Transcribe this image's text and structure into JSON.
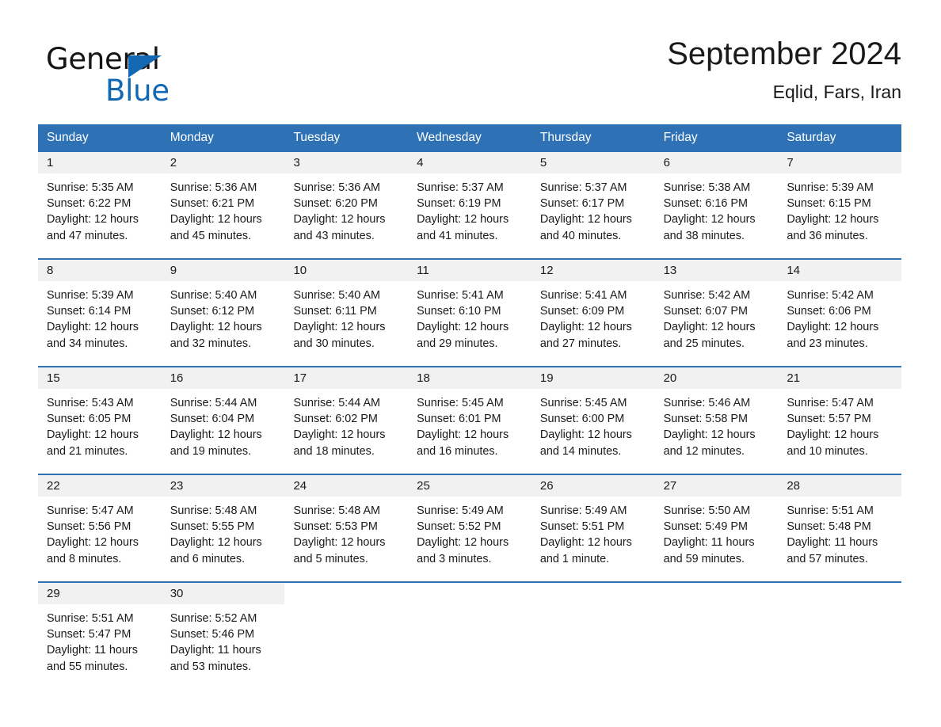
{
  "brand": {
    "name_dark": "General",
    "name_blue": "Blue",
    "accent_color": "#1268b3"
  },
  "header": {
    "month_title": "September 2024",
    "location": "Eqlid, Fars, Iran"
  },
  "theme": {
    "header_blue": "#2e72b5",
    "daynum_band": "#f1f1f1",
    "text": "#1a1a1a"
  },
  "weekdays": [
    "Sunday",
    "Monday",
    "Tuesday",
    "Wednesday",
    "Thursday",
    "Friday",
    "Saturday"
  ],
  "weeks": [
    {
      "days": [
        {
          "num": "1",
          "sunrise": "Sunrise: 5:35 AM",
          "sunset": "Sunset: 6:22 PM",
          "daylight1": "Daylight: 12 hours",
          "daylight2": "and 47 minutes."
        },
        {
          "num": "2",
          "sunrise": "Sunrise: 5:36 AM",
          "sunset": "Sunset: 6:21 PM",
          "daylight1": "Daylight: 12 hours",
          "daylight2": "and 45 minutes."
        },
        {
          "num": "3",
          "sunrise": "Sunrise: 5:36 AM",
          "sunset": "Sunset: 6:20 PM",
          "daylight1": "Daylight: 12 hours",
          "daylight2": "and 43 minutes."
        },
        {
          "num": "4",
          "sunrise": "Sunrise: 5:37 AM",
          "sunset": "Sunset: 6:19 PM",
          "daylight1": "Daylight: 12 hours",
          "daylight2": "and 41 minutes."
        },
        {
          "num": "5",
          "sunrise": "Sunrise: 5:37 AM",
          "sunset": "Sunset: 6:17 PM",
          "daylight1": "Daylight: 12 hours",
          "daylight2": "and 40 minutes."
        },
        {
          "num": "6",
          "sunrise": "Sunrise: 5:38 AM",
          "sunset": "Sunset: 6:16 PM",
          "daylight1": "Daylight: 12 hours",
          "daylight2": "and 38 minutes."
        },
        {
          "num": "7",
          "sunrise": "Sunrise: 5:39 AM",
          "sunset": "Sunset: 6:15 PM",
          "daylight1": "Daylight: 12 hours",
          "daylight2": "and 36 minutes."
        }
      ]
    },
    {
      "days": [
        {
          "num": "8",
          "sunrise": "Sunrise: 5:39 AM",
          "sunset": "Sunset: 6:14 PM",
          "daylight1": "Daylight: 12 hours",
          "daylight2": "and 34 minutes."
        },
        {
          "num": "9",
          "sunrise": "Sunrise: 5:40 AM",
          "sunset": "Sunset: 6:12 PM",
          "daylight1": "Daylight: 12 hours",
          "daylight2": "and 32 minutes."
        },
        {
          "num": "10",
          "sunrise": "Sunrise: 5:40 AM",
          "sunset": "Sunset: 6:11 PM",
          "daylight1": "Daylight: 12 hours",
          "daylight2": "and 30 minutes."
        },
        {
          "num": "11",
          "sunrise": "Sunrise: 5:41 AM",
          "sunset": "Sunset: 6:10 PM",
          "daylight1": "Daylight: 12 hours",
          "daylight2": "and 29 minutes."
        },
        {
          "num": "12",
          "sunrise": "Sunrise: 5:41 AM",
          "sunset": "Sunset: 6:09 PM",
          "daylight1": "Daylight: 12 hours",
          "daylight2": "and 27 minutes."
        },
        {
          "num": "13",
          "sunrise": "Sunrise: 5:42 AM",
          "sunset": "Sunset: 6:07 PM",
          "daylight1": "Daylight: 12 hours",
          "daylight2": "and 25 minutes."
        },
        {
          "num": "14",
          "sunrise": "Sunrise: 5:42 AM",
          "sunset": "Sunset: 6:06 PM",
          "daylight1": "Daylight: 12 hours",
          "daylight2": "and 23 minutes."
        }
      ]
    },
    {
      "days": [
        {
          "num": "15",
          "sunrise": "Sunrise: 5:43 AM",
          "sunset": "Sunset: 6:05 PM",
          "daylight1": "Daylight: 12 hours",
          "daylight2": "and 21 minutes."
        },
        {
          "num": "16",
          "sunrise": "Sunrise: 5:44 AM",
          "sunset": "Sunset: 6:04 PM",
          "daylight1": "Daylight: 12 hours",
          "daylight2": "and 19 minutes."
        },
        {
          "num": "17",
          "sunrise": "Sunrise: 5:44 AM",
          "sunset": "Sunset: 6:02 PM",
          "daylight1": "Daylight: 12 hours",
          "daylight2": "and 18 minutes."
        },
        {
          "num": "18",
          "sunrise": "Sunrise: 5:45 AM",
          "sunset": "Sunset: 6:01 PM",
          "daylight1": "Daylight: 12 hours",
          "daylight2": "and 16 minutes."
        },
        {
          "num": "19",
          "sunrise": "Sunrise: 5:45 AM",
          "sunset": "Sunset: 6:00 PM",
          "daylight1": "Daylight: 12 hours",
          "daylight2": "and 14 minutes."
        },
        {
          "num": "20",
          "sunrise": "Sunrise: 5:46 AM",
          "sunset": "Sunset: 5:58 PM",
          "daylight1": "Daylight: 12 hours",
          "daylight2": "and 12 minutes."
        },
        {
          "num": "21",
          "sunrise": "Sunrise: 5:47 AM",
          "sunset": "Sunset: 5:57 PM",
          "daylight1": "Daylight: 12 hours",
          "daylight2": "and 10 minutes."
        }
      ]
    },
    {
      "days": [
        {
          "num": "22",
          "sunrise": "Sunrise: 5:47 AM",
          "sunset": "Sunset: 5:56 PM",
          "daylight1": "Daylight: 12 hours",
          "daylight2": "and 8 minutes."
        },
        {
          "num": "23",
          "sunrise": "Sunrise: 5:48 AM",
          "sunset": "Sunset: 5:55 PM",
          "daylight1": "Daylight: 12 hours",
          "daylight2": "and 6 minutes."
        },
        {
          "num": "24",
          "sunrise": "Sunrise: 5:48 AM",
          "sunset": "Sunset: 5:53 PM",
          "daylight1": "Daylight: 12 hours",
          "daylight2": "and 5 minutes."
        },
        {
          "num": "25",
          "sunrise": "Sunrise: 5:49 AM",
          "sunset": "Sunset: 5:52 PM",
          "daylight1": "Daylight: 12 hours",
          "daylight2": "and 3 minutes."
        },
        {
          "num": "26",
          "sunrise": "Sunrise: 5:49 AM",
          "sunset": "Sunset: 5:51 PM",
          "daylight1": "Daylight: 12 hours",
          "daylight2": "and 1 minute."
        },
        {
          "num": "27",
          "sunrise": "Sunrise: 5:50 AM",
          "sunset": "Sunset: 5:49 PM",
          "daylight1": "Daylight: 11 hours",
          "daylight2": "and 59 minutes."
        },
        {
          "num": "28",
          "sunrise": "Sunrise: 5:51 AM",
          "sunset": "Sunset: 5:48 PM",
          "daylight1": "Daylight: 11 hours",
          "daylight2": "and 57 minutes."
        }
      ]
    },
    {
      "days": [
        {
          "num": "29",
          "sunrise": "Sunrise: 5:51 AM",
          "sunset": "Sunset: 5:47 PM",
          "daylight1": "Daylight: 11 hours",
          "daylight2": "and 55 minutes."
        },
        {
          "num": "30",
          "sunrise": "Sunrise: 5:52 AM",
          "sunset": "Sunset: 5:46 PM",
          "daylight1": "Daylight: 11 hours",
          "daylight2": "and 53 minutes."
        },
        {
          "num": "",
          "sunrise": "",
          "sunset": "",
          "daylight1": "",
          "daylight2": ""
        },
        {
          "num": "",
          "sunrise": "",
          "sunset": "",
          "daylight1": "",
          "daylight2": ""
        },
        {
          "num": "",
          "sunrise": "",
          "sunset": "",
          "daylight1": "",
          "daylight2": ""
        },
        {
          "num": "",
          "sunrise": "",
          "sunset": "",
          "daylight1": "",
          "daylight2": ""
        },
        {
          "num": "",
          "sunrise": "",
          "sunset": "",
          "daylight1": "",
          "daylight2": ""
        }
      ]
    }
  ]
}
